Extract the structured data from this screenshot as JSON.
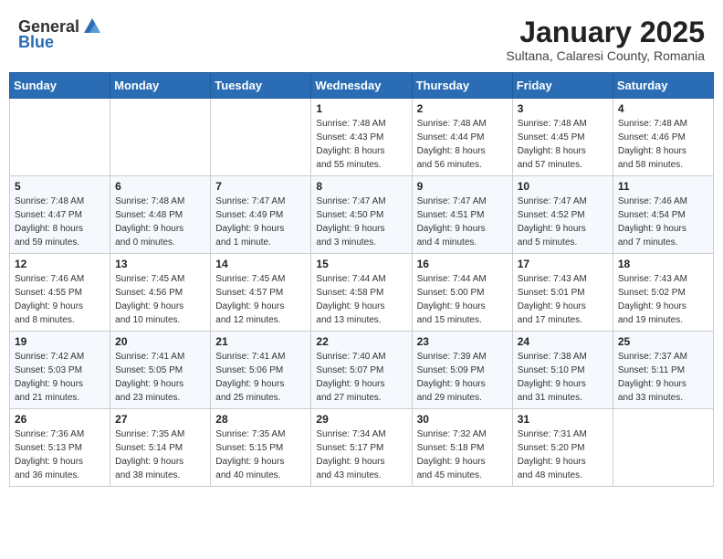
{
  "header": {
    "logo_general": "General",
    "logo_blue": "Blue",
    "title": "January 2025",
    "subtitle": "Sultana, Calaresi County, Romania"
  },
  "weekdays": [
    "Sunday",
    "Monday",
    "Tuesday",
    "Wednesday",
    "Thursday",
    "Friday",
    "Saturday"
  ],
  "weeks": [
    [
      {
        "day": "",
        "info": ""
      },
      {
        "day": "",
        "info": ""
      },
      {
        "day": "",
        "info": ""
      },
      {
        "day": "1",
        "info": "Sunrise: 7:48 AM\nSunset: 4:43 PM\nDaylight: 8 hours\nand 55 minutes."
      },
      {
        "day": "2",
        "info": "Sunrise: 7:48 AM\nSunset: 4:44 PM\nDaylight: 8 hours\nand 56 minutes."
      },
      {
        "day": "3",
        "info": "Sunrise: 7:48 AM\nSunset: 4:45 PM\nDaylight: 8 hours\nand 57 minutes."
      },
      {
        "day": "4",
        "info": "Sunrise: 7:48 AM\nSunset: 4:46 PM\nDaylight: 8 hours\nand 58 minutes."
      }
    ],
    [
      {
        "day": "5",
        "info": "Sunrise: 7:48 AM\nSunset: 4:47 PM\nDaylight: 8 hours\nand 59 minutes."
      },
      {
        "day": "6",
        "info": "Sunrise: 7:48 AM\nSunset: 4:48 PM\nDaylight: 9 hours\nand 0 minutes."
      },
      {
        "day": "7",
        "info": "Sunrise: 7:47 AM\nSunset: 4:49 PM\nDaylight: 9 hours\nand 1 minute."
      },
      {
        "day": "8",
        "info": "Sunrise: 7:47 AM\nSunset: 4:50 PM\nDaylight: 9 hours\nand 3 minutes."
      },
      {
        "day": "9",
        "info": "Sunrise: 7:47 AM\nSunset: 4:51 PM\nDaylight: 9 hours\nand 4 minutes."
      },
      {
        "day": "10",
        "info": "Sunrise: 7:47 AM\nSunset: 4:52 PM\nDaylight: 9 hours\nand 5 minutes."
      },
      {
        "day": "11",
        "info": "Sunrise: 7:46 AM\nSunset: 4:54 PM\nDaylight: 9 hours\nand 7 minutes."
      }
    ],
    [
      {
        "day": "12",
        "info": "Sunrise: 7:46 AM\nSunset: 4:55 PM\nDaylight: 9 hours\nand 8 minutes."
      },
      {
        "day": "13",
        "info": "Sunrise: 7:45 AM\nSunset: 4:56 PM\nDaylight: 9 hours\nand 10 minutes."
      },
      {
        "day": "14",
        "info": "Sunrise: 7:45 AM\nSunset: 4:57 PM\nDaylight: 9 hours\nand 12 minutes."
      },
      {
        "day": "15",
        "info": "Sunrise: 7:44 AM\nSunset: 4:58 PM\nDaylight: 9 hours\nand 13 minutes."
      },
      {
        "day": "16",
        "info": "Sunrise: 7:44 AM\nSunset: 5:00 PM\nDaylight: 9 hours\nand 15 minutes."
      },
      {
        "day": "17",
        "info": "Sunrise: 7:43 AM\nSunset: 5:01 PM\nDaylight: 9 hours\nand 17 minutes."
      },
      {
        "day": "18",
        "info": "Sunrise: 7:43 AM\nSunset: 5:02 PM\nDaylight: 9 hours\nand 19 minutes."
      }
    ],
    [
      {
        "day": "19",
        "info": "Sunrise: 7:42 AM\nSunset: 5:03 PM\nDaylight: 9 hours\nand 21 minutes."
      },
      {
        "day": "20",
        "info": "Sunrise: 7:41 AM\nSunset: 5:05 PM\nDaylight: 9 hours\nand 23 minutes."
      },
      {
        "day": "21",
        "info": "Sunrise: 7:41 AM\nSunset: 5:06 PM\nDaylight: 9 hours\nand 25 minutes."
      },
      {
        "day": "22",
        "info": "Sunrise: 7:40 AM\nSunset: 5:07 PM\nDaylight: 9 hours\nand 27 minutes."
      },
      {
        "day": "23",
        "info": "Sunrise: 7:39 AM\nSunset: 5:09 PM\nDaylight: 9 hours\nand 29 minutes."
      },
      {
        "day": "24",
        "info": "Sunrise: 7:38 AM\nSunset: 5:10 PM\nDaylight: 9 hours\nand 31 minutes."
      },
      {
        "day": "25",
        "info": "Sunrise: 7:37 AM\nSunset: 5:11 PM\nDaylight: 9 hours\nand 33 minutes."
      }
    ],
    [
      {
        "day": "26",
        "info": "Sunrise: 7:36 AM\nSunset: 5:13 PM\nDaylight: 9 hours\nand 36 minutes."
      },
      {
        "day": "27",
        "info": "Sunrise: 7:35 AM\nSunset: 5:14 PM\nDaylight: 9 hours\nand 38 minutes."
      },
      {
        "day": "28",
        "info": "Sunrise: 7:35 AM\nSunset: 5:15 PM\nDaylight: 9 hours\nand 40 minutes."
      },
      {
        "day": "29",
        "info": "Sunrise: 7:34 AM\nSunset: 5:17 PM\nDaylight: 9 hours\nand 43 minutes."
      },
      {
        "day": "30",
        "info": "Sunrise: 7:32 AM\nSunset: 5:18 PM\nDaylight: 9 hours\nand 45 minutes."
      },
      {
        "day": "31",
        "info": "Sunrise: 7:31 AM\nSunset: 5:20 PM\nDaylight: 9 hours\nand 48 minutes."
      },
      {
        "day": "",
        "info": ""
      }
    ]
  ]
}
